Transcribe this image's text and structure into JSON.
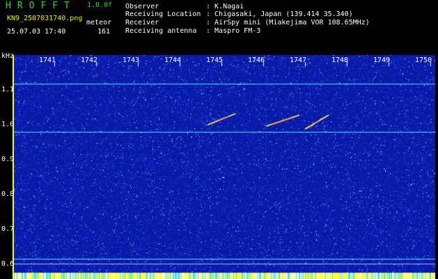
{
  "header": {
    "app_title": "HROFFT",
    "version": "1.0.0f",
    "file_name": "KN9_2507031740.png",
    "detection_label": "meteor",
    "timestamp": "25.07.03 17:40",
    "detection_count": "161"
  },
  "info": [
    {
      "label": "Observer",
      "value": ": K.Nagai"
    },
    {
      "label": "Receiving Location",
      "value": ": Chigasaki, Japan (139.414 35.340)"
    },
    {
      "label": "Receiver",
      "value": ": AirSpy mini (Miakejima VOR 108.65MHz)"
    },
    {
      "label": "Receiving antenna",
      "value": ": Maspro FM-3"
    }
  ],
  "axes": {
    "unit": "kHz",
    "y_ticks": [
      "1.1",
      "1.0",
      "0.9",
      "0.8",
      "0.7",
      "0.6"
    ],
    "x_ticks": [
      "1741",
      "1742",
      "1743",
      "1744",
      "1745",
      "1746",
      "1747",
      "1748",
      "1749",
      "1750"
    ]
  },
  "colors": {
    "background": "#0a1aa8",
    "noise_light": "#3ad0ff",
    "noise_mid": "#2050ff",
    "trace": "#ffff40",
    "header_green": "#22dd22",
    "header_yellow": "#f0f000",
    "axis": "#ffff00"
  }
}
